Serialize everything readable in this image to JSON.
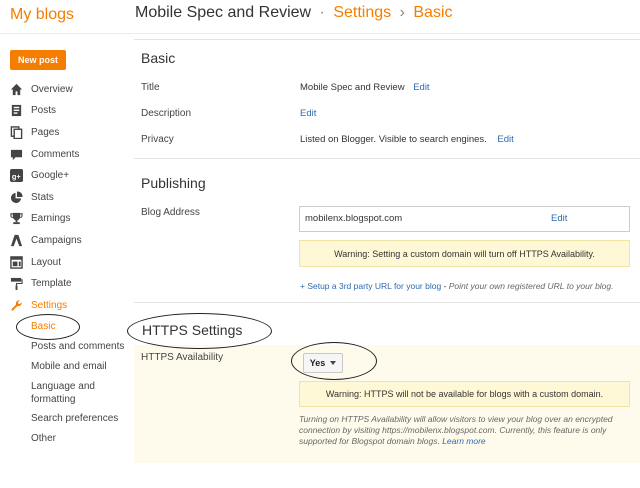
{
  "header": {
    "brand": "My blogs",
    "blog_name": "Mobile Spec and Review",
    "sep1": "·",
    "section": "Settings",
    "sep2": "›",
    "page": "Basic"
  },
  "sidebar": {
    "new_post_label": "New post",
    "items": [
      {
        "label": "Overview",
        "icon": "home-icon"
      },
      {
        "label": "Posts",
        "icon": "posts-icon"
      },
      {
        "label": "Pages",
        "icon": "pages-icon"
      },
      {
        "label": "Comments",
        "icon": "comment-icon"
      },
      {
        "label": "Google+",
        "icon": "google-plus-icon"
      },
      {
        "label": "Stats",
        "icon": "pie-chart-icon"
      },
      {
        "label": "Earnings",
        "icon": "trophy-icon"
      },
      {
        "label": "Campaigns",
        "icon": "campaigns-icon"
      },
      {
        "label": "Layout",
        "icon": "layout-icon"
      },
      {
        "label": "Template",
        "icon": "paint-roller-icon"
      },
      {
        "label": "Settings",
        "icon": "wrench-icon"
      }
    ],
    "settings_sub": [
      {
        "label": "Basic"
      },
      {
        "label": "Posts and comments"
      },
      {
        "label": "Mobile and email"
      },
      {
        "label": "Language and"
      },
      {
        "label": "formatting"
      },
      {
        "label": "Search preferences"
      },
      {
        "label": "Other"
      }
    ]
  },
  "basic": {
    "heading": "Basic",
    "title_label": "Title",
    "title_value": "Mobile Spec and Review",
    "edit": "Edit",
    "description_label": "Description",
    "privacy_label": "Privacy",
    "privacy_value": "Listed on Blogger. Visible to search engines."
  },
  "publishing": {
    "heading": "Publishing",
    "address_label": "Blog Address",
    "address_value": "mobilenx.blogspot.com",
    "edit": "Edit",
    "warning": "Warning: Setting a custom domain will turn off HTTPS Availability.",
    "setup_link": "+ Setup a 3rd party URL for your blog",
    "setup_dash": " - ",
    "setup_hint": "Point your own registered URL to your blog."
  },
  "https": {
    "heading": "HTTPS Settings",
    "availability_label": "HTTPS Availability",
    "availability_value": "Yes",
    "warning": "Warning: HTTPS will not be available for blogs with a custom domain.",
    "help_text": "Turning on HTTPS Availability will allow visitors to view your blog over an encrypted connection by visiting https://mobilenx.blogspot.com. Currently, this feature is only supported for Blogspot domain blogs.",
    "learn_more": "Learn more"
  },
  "colors": {
    "accent": "#f57d00",
    "link": "#2f69b3",
    "warning_bg": "#fff8d7",
    "https_band_bg": "#fffbec"
  }
}
